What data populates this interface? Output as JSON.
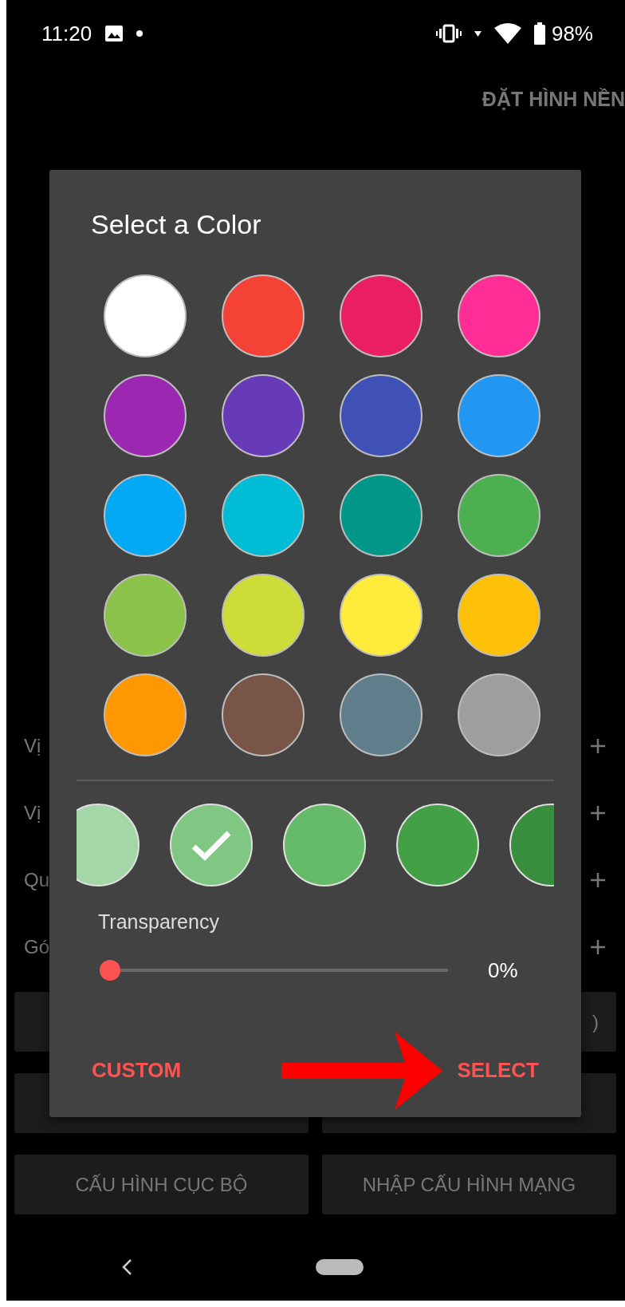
{
  "status_bar": {
    "time": "11:20",
    "battery": "98%"
  },
  "app_bar": {
    "action": "ĐẶT HÌNH NỀN"
  },
  "settings_rows": [
    {
      "label": "Vị"
    },
    {
      "label": "Vị"
    },
    {
      "label": "Qu"
    },
    {
      "label": "Gó"
    }
  ],
  "buttons": [
    {
      "kind": "blank"
    },
    {
      "kind": "text",
      "label": ")"
    },
    {
      "kind": "blank"
    },
    {
      "kind": "blank"
    },
    {
      "kind": "text",
      "label": "CẤU HÌNH CỤC BỘ"
    },
    {
      "kind": "text",
      "label": "NHẬP CẤU HÌNH MẠNG"
    }
  ],
  "dialog": {
    "title": "Select a Color",
    "colors": [
      {
        "color": "#ffffff"
      },
      {
        "color": "#f44336"
      },
      {
        "color": "#e91e63"
      },
      {
        "color": "#ff2d95"
      },
      {
        "color": "#9c27b0"
      },
      {
        "color": "#673ab7"
      },
      {
        "color": "#3f51b5"
      },
      {
        "color": "#2196f3"
      },
      {
        "color": "#03a9f4"
      },
      {
        "color": "#00bcd4"
      },
      {
        "color": "#009688"
      },
      {
        "color": "#4caf50"
      },
      {
        "color": "#8bc34a"
      },
      {
        "color": "#cddc39"
      },
      {
        "color": "#ffeb3b"
      },
      {
        "color": "#ffc107"
      },
      {
        "color": "#ff9800"
      },
      {
        "color": "#795548"
      },
      {
        "color": "#607d8b"
      },
      {
        "color": "#9e9e9e"
      }
    ],
    "shades": [
      {
        "color": "#a5d6a7",
        "selected": false
      },
      {
        "color": "#81c784",
        "selected": true
      },
      {
        "color": "#66bb6a",
        "selected": false
      },
      {
        "color": "#43a047",
        "selected": false
      },
      {
        "color": "#388e3c",
        "selected": false
      }
    ],
    "transparency": {
      "label": "Transparency",
      "level": 0,
      "reading": "0%"
    },
    "actions": [
      "CUSTOM",
      "SELECT"
    ]
  }
}
